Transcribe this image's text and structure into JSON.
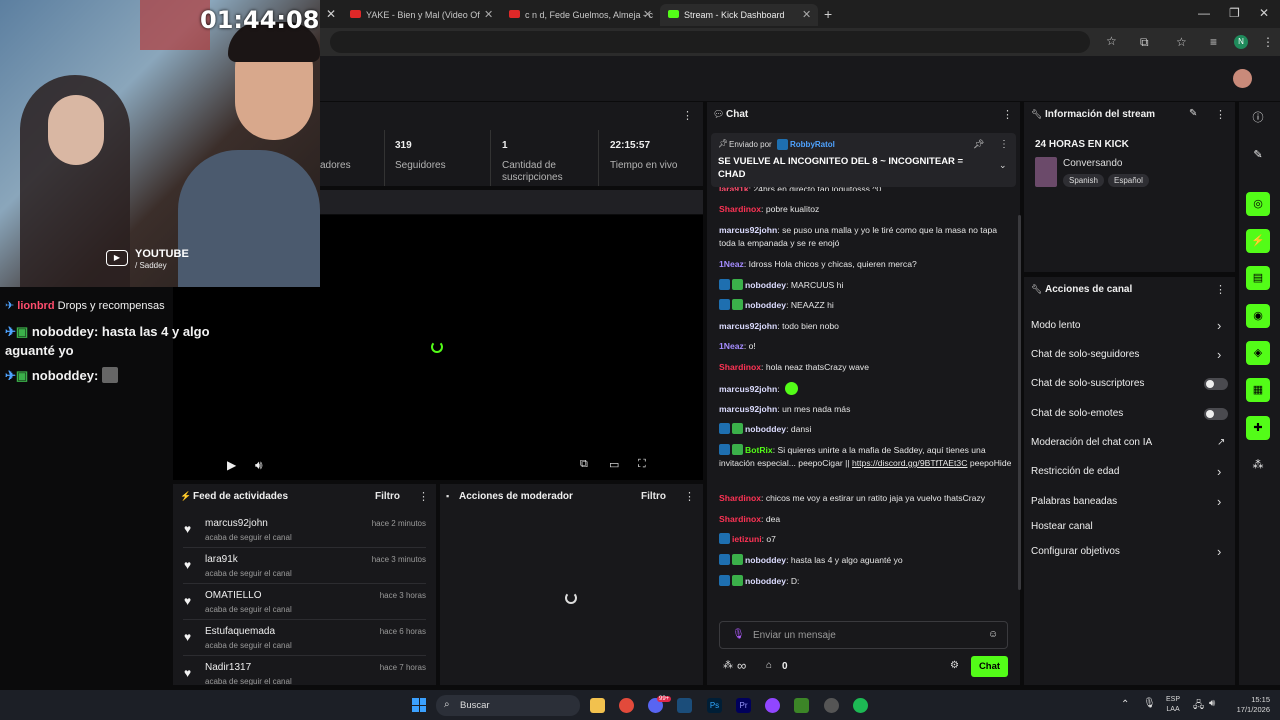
{
  "browser": {
    "tabs": [
      {
        "title": "YAKE - Bien y Mal (Video Of"
      },
      {
        "title": "c n d, Fede Guelmos, Almeja - c"
      },
      {
        "title": "Stream - Kick Dashboard"
      }
    ],
    "profile_initial": "N"
  },
  "overlay": {
    "timer": "01:44:08",
    "youtube_label": "YOUTUBE",
    "youtube_handle": "/ Saddey",
    "chat": [
      {
        "user": "lionbrd",
        "text": "Drops y recompensas"
      },
      {
        "user": "noboddey",
        "text": "hasta las 4 y algo aguanté yo"
      },
      {
        "user": "noboddey",
        "text": ""
      }
    ]
  },
  "stats": {
    "items": [
      {
        "value": "",
        "label": "adores"
      },
      {
        "value": "319",
        "label": "Seguidores"
      },
      {
        "value": "1",
        "label": "Cantidad de suscripciones"
      },
      {
        "value": "22:15:57",
        "label": "Tiempo en vivo"
      }
    ]
  },
  "feed": {
    "title": "Feed de actividades",
    "filter": "Filtro",
    "items": [
      {
        "name": "marcus92john",
        "sub": "acaba de seguir el canal",
        "time": "hace 2 minutos"
      },
      {
        "name": "lara91k",
        "sub": "acaba de seguir el canal",
        "time": "hace 3 minutos"
      },
      {
        "name": "OMATIELLO",
        "sub": "acaba de seguir el canal",
        "time": "hace 3 horas"
      },
      {
        "name": "Estufaquemada",
        "sub": "acaba de seguir el canal",
        "time": "hace 6 horas"
      },
      {
        "name": "Nadir1317",
        "sub": "acaba de seguir el canal",
        "time": "hace 7 horas"
      }
    ]
  },
  "mod_actions": {
    "title": "Acciones de moderador",
    "filter": "Filtro"
  },
  "chat": {
    "title": "Chat",
    "pinned_by_label": "Enviado por",
    "pinned_by_user": "RobbyRatol",
    "pinned_text": "SE VUELVE AL INCOGNITEO DEL 8 ~ INCOGNITEAR = CHAD",
    "messages": [
      {
        "user": "lara91k",
        "text": "24hrs en directo tan loquitosss ^0",
        "color": "#ff4d6d"
      },
      {
        "user": "Shardinox",
        "text": "pobre kualitoz",
        "color": "#ff3355"
      },
      {
        "user": "marcus92john",
        "text": "se puso una malla y yo le tiré como que la masa no tapa toda la empanada y se re enojó",
        "color": "#dcdcff"
      },
      {
        "user": "1Neaz",
        "text": "Idross Hola chicos y chicas, quieren merca?",
        "color": "#a58cff"
      },
      {
        "user": "noboddey",
        "text": "MARCUUS hi",
        "color": "#dcdcff",
        "badges": 2
      },
      {
        "user": "noboddey",
        "text": "NEAAZZ hi",
        "color": "#dcdcff",
        "badges": 2
      },
      {
        "user": "marcus92john",
        "text": "todo bien nobo",
        "color": "#dcdcff"
      },
      {
        "user": "1Neaz",
        "text": "o!",
        "color": "#a58cff"
      },
      {
        "user": "Shardinox",
        "text": "hola neaz thatsCrazy wave",
        "color": "#ff3355"
      },
      {
        "user": "marcus92john",
        "text": "",
        "color": "#dcdcff"
      },
      {
        "user": "marcus92john",
        "text": "un mes nada más",
        "color": "#dcdcff"
      },
      {
        "user": "noboddey",
        "text": "dansi",
        "color": "#dcdcff",
        "badges": 2
      },
      {
        "user": "BotRix",
        "text": "Si quieres unirte a la mafia de Saddey, aquí tienes una invitación especial... peepoCigar ||",
        "link": "https://discord.gg/9BTfTAEt3C",
        "after": "peepoHide",
        "color": "#53fc18",
        "badges": 2
      },
      {
        "user": "Shardinox",
        "text": "chicos me voy a estirar un ratito jaja ya vuelvo thatsCrazy",
        "color": "#ff3355"
      },
      {
        "user": "Shardinox",
        "text": "dea",
        "color": "#ff3355"
      },
      {
        "user": "ietizuni",
        "text": "o7",
        "color": "#ff3355",
        "badges": 1
      },
      {
        "user": "noboddey",
        "text": "hasta las 4 y algo aguanté yo",
        "color": "#dcdcff",
        "badges": 2
      },
      {
        "user": "noboddey",
        "text": "D:",
        "color": "#dcdcff",
        "badges": 2
      }
    ],
    "input_placeholder": "Enviar un mensaje",
    "infinity": "∞",
    "count": "0",
    "send_label": "Chat"
  },
  "stream_info": {
    "title_label": "Información del stream",
    "stream_title": "24 HORAS EN KICK",
    "category": "Conversando",
    "tags": [
      "Spanish",
      "Español"
    ]
  },
  "channel_actions": {
    "title": "Acciones de canal",
    "items": [
      {
        "label": "Modo lento",
        "control": "chevron"
      },
      {
        "label": "Chat de solo-seguidores",
        "control": "chevron"
      },
      {
        "label": "Chat de solo-suscriptores",
        "control": "toggle"
      },
      {
        "label": "Chat de solo-emotes",
        "control": "toggle"
      },
      {
        "label": "Moderación del chat con IA",
        "control": "external"
      },
      {
        "label": "Restricción de edad",
        "control": "chevron"
      },
      {
        "label": "Palabras baneadas",
        "control": "chevron"
      },
      {
        "label": "Hostear canal",
        "control": "none"
      },
      {
        "label": "Configurar objetivos",
        "control": "chevron"
      }
    ]
  },
  "taskbar": {
    "search": "Buscar",
    "lang_top": "ESP",
    "lang_bottom": "LAA",
    "time": "15:15",
    "date": "17/1/2026",
    "chat_badge": "99+"
  }
}
